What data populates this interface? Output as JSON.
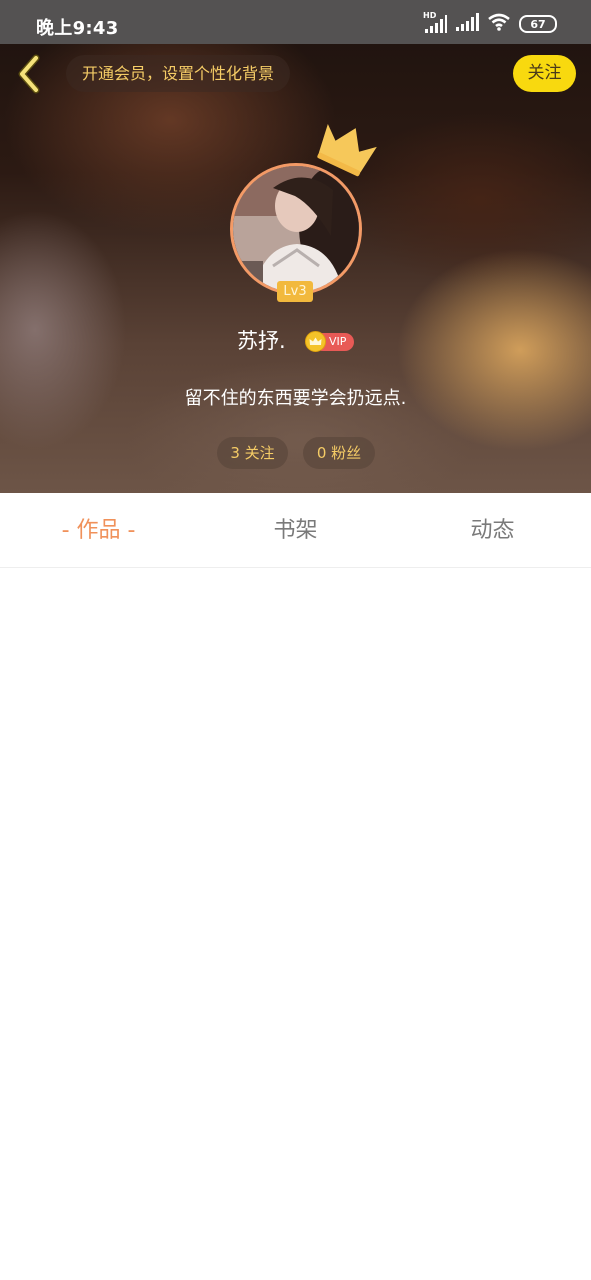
{
  "status_bar": {
    "time": "晚上9:43",
    "network_label": "HD",
    "battery": "67",
    "icons": [
      "hd-signal-icon",
      "signal-icon",
      "wifi-icon",
      "battery-icon"
    ]
  },
  "header": {
    "vip_banner": "开通会员，设置个性化背景",
    "follow_label": "关注"
  },
  "profile": {
    "level": "Lv3",
    "username": "苏抒.",
    "vip_label": "VIP",
    "bio": "留不住的东西要学会扔远点.",
    "following": "3 关注",
    "followers": "0 粉丝"
  },
  "tabs": [
    {
      "label": "- 作品 -",
      "active": true
    },
    {
      "label": "书架",
      "active": false
    },
    {
      "label": "动态",
      "active": false
    }
  ],
  "colors": {
    "accent": "#f0915a",
    "follow_button": "#f8d90f",
    "gold_text": "#f5cc66",
    "vip_red": "#e85a56"
  }
}
